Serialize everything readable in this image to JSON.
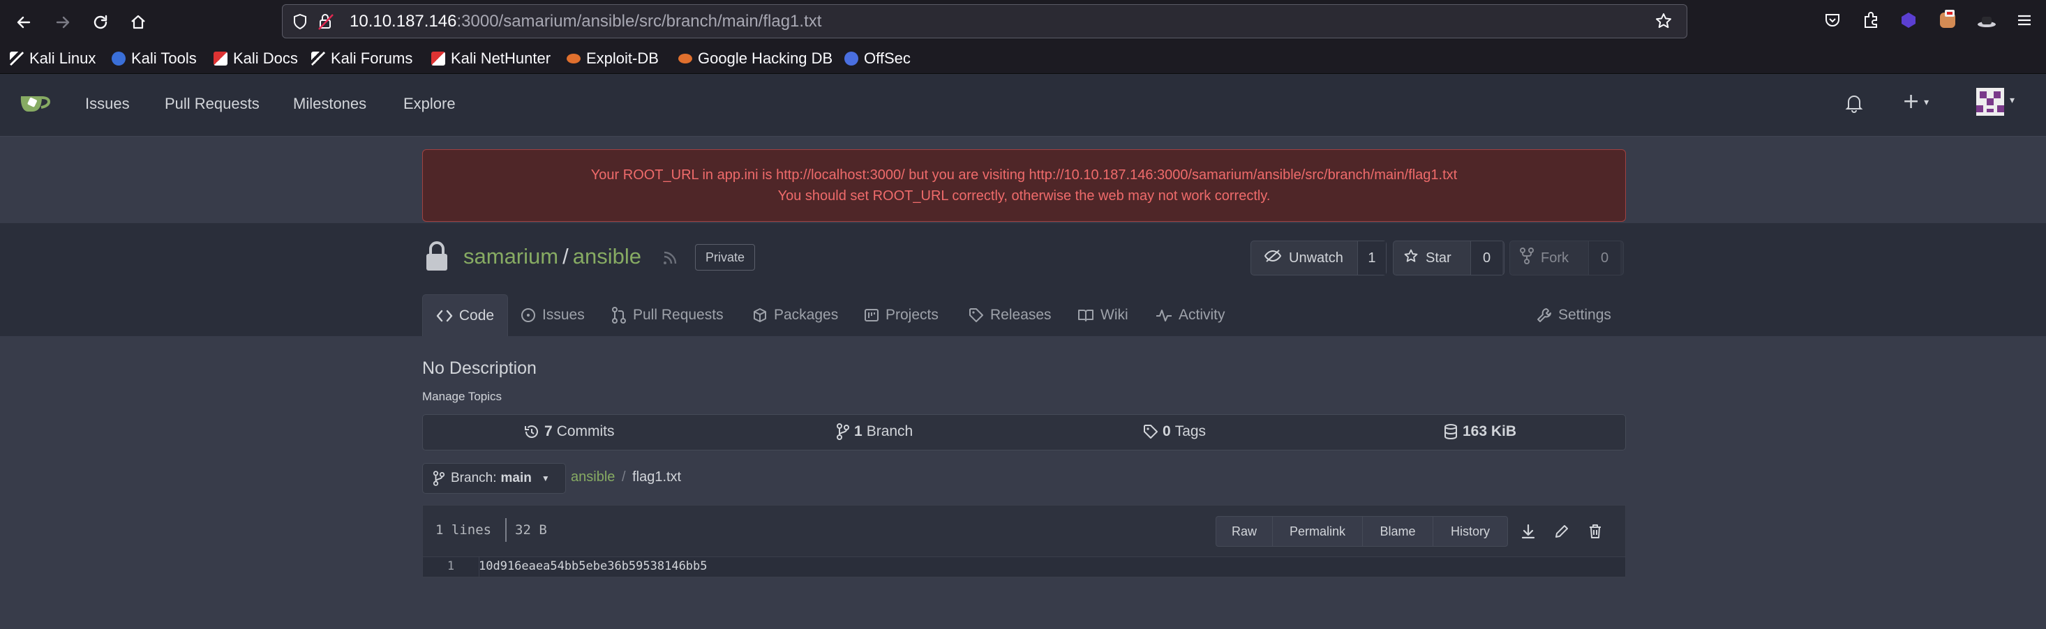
{
  "browser": {
    "url_host": "10.10.187.146",
    "url_path": ":3000/samarium/ansible/src/branch/main/flag1.txt",
    "bookmarks": [
      "Kali Linux",
      "Kali Tools",
      "Kali Docs",
      "Kali Forums",
      "Kali NetHunter",
      "Exploit-DB",
      "Google Hacking DB",
      "OffSec"
    ]
  },
  "nav": {
    "items": [
      "Issues",
      "Pull Requests",
      "Milestones",
      "Explore"
    ],
    "plus_label": "+"
  },
  "warning": {
    "line1": "Your ROOT_URL in app.ini is http://localhost:3000/ but you are visiting http://10.10.187.146:3000/samarium/ansible/src/branch/main/flag1.txt",
    "line2": "You should set ROOT_URL correctly, otherwise the web may not work correctly."
  },
  "repo": {
    "owner": "samarium",
    "separator": "/",
    "name": "ansible",
    "visibility": "Private",
    "unwatch_label": "Unwatch",
    "watch_count": "1",
    "star_label": "Star",
    "star_count": "0",
    "fork_label": "Fork",
    "fork_count": "0"
  },
  "tabs": [
    "Code",
    "Issues",
    "Pull Requests",
    "Packages",
    "Projects",
    "Releases",
    "Wiki",
    "Activity",
    "Settings"
  ],
  "description": "No Description",
  "manage_topics": "Manage Topics",
  "stats": {
    "commits_num": "7",
    "commits_label": "Commits",
    "branch_num": "1",
    "branch_label": "Branch",
    "tags_num": "0",
    "tags_label": "Tags",
    "size": "163 KiB"
  },
  "branch": {
    "prefix": "Branch:",
    "name": "main",
    "crumb_repo": "ansible",
    "crumb_sep": "/",
    "crumb_file": "flag1.txt"
  },
  "file": {
    "lines": "1 lines",
    "size": "32 B",
    "buttons": [
      "Raw",
      "Permalink",
      "Blame",
      "History"
    ],
    "line_number": "1",
    "content": "10d916eaea54bb5ebe36b59538146bb5"
  },
  "colors": {
    "accent_green": "#87ab63",
    "warning_text": "#ef6b6b",
    "warning_bg": "#4f2628"
  }
}
